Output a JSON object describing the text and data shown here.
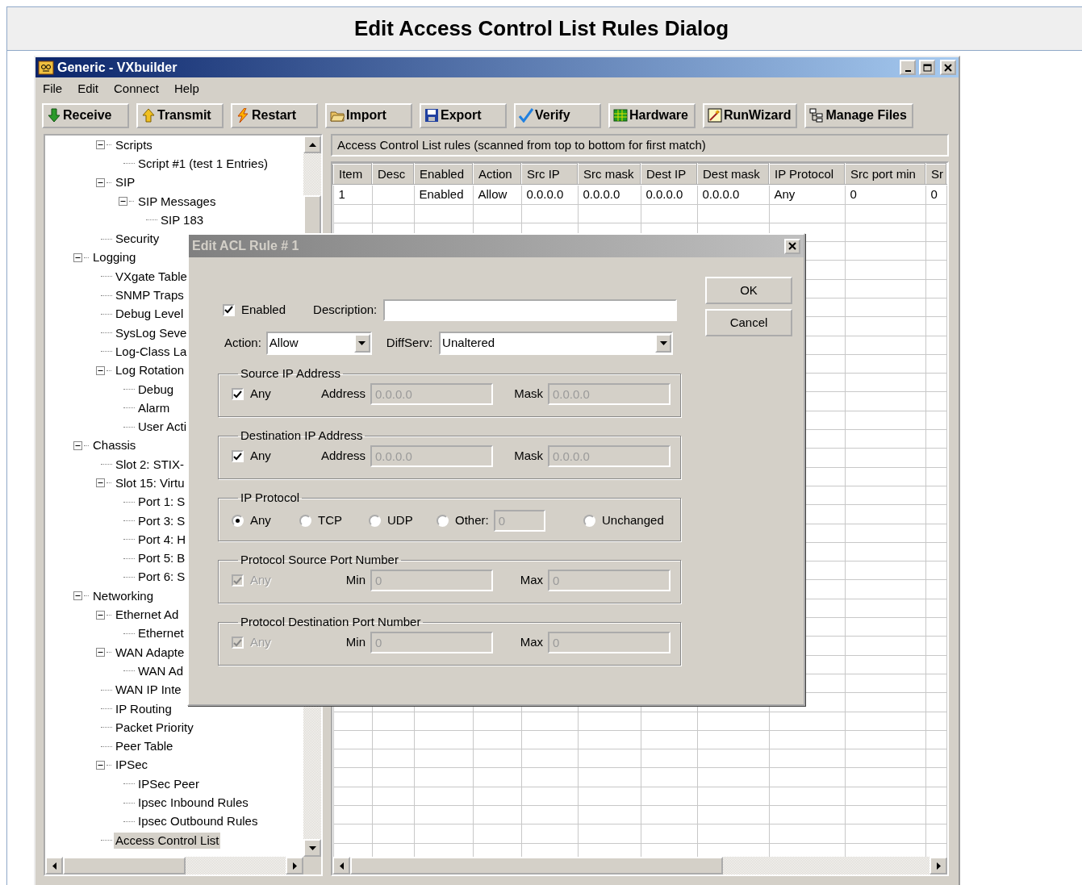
{
  "page_title": "Edit Access Control List Rules Dialog",
  "window": {
    "title": "Generic - VXbuilder"
  },
  "menu": [
    "File",
    "Edit",
    "Connect",
    "Help"
  ],
  "toolbar": [
    "Receive",
    "Transmit",
    "Restart",
    "Import",
    "Export",
    "Verify",
    "Hardware",
    "RunWizard",
    "Manage Files"
  ],
  "tree": {
    "items": [
      {
        "children": [
          {
            "label": "Scripts",
            "expanded": true,
            "selected": false,
            "children": [
              {
                "label": "Script #1 (test 1 Entries)",
                "selected": false
              }
            ]
          },
          {
            "label": "SIP",
            "expanded": true,
            "selected": false,
            "children": [
              {
                "label": "SIP Messages",
                "expanded": true,
                "selected": false,
                "children": [
                  {
                    "label": "SIP 183",
                    "selected": false
                  }
                ]
              }
            ]
          },
          {
            "label": "Security",
            "selected": false
          }
        ]
      },
      {
        "label": "Logging",
        "expanded": true,
        "selected": false,
        "children": [
          {
            "label": "VXgate Table",
            "selected": false
          },
          {
            "label": "SNMP Traps",
            "selected": false
          },
          {
            "label": "Debug Level",
            "selected": false
          },
          {
            "label": "SysLog Seve",
            "selected": false
          },
          {
            "label": "Log-Class La",
            "selected": false
          },
          {
            "label": "Log Rotation",
            "expanded": true,
            "selected": false,
            "children": [
              {
                "label": "Debug",
                "selected": false
              },
              {
                "label": "Alarm",
                "selected": false
              },
              {
                "label": "User Acti",
                "selected": false
              }
            ]
          }
        ]
      },
      {
        "label": "Chassis",
        "expanded": true,
        "selected": false,
        "children": [
          {
            "label": "Slot 2: STIX-",
            "selected": false
          },
          {
            "label": "Slot 15: Virtu",
            "expanded": true,
            "selected": false,
            "children": [
              {
                "label": "Port 1: S",
                "selected": false
              },
              {
                "label": "Port 3: S",
                "selected": false
              },
              {
                "label": "Port 4: H",
                "selected": false
              },
              {
                "label": "Port 5: B",
                "selected": false
              },
              {
                "label": "Port 6: S",
                "selected": false
              }
            ]
          }
        ]
      },
      {
        "label": "Networking",
        "expanded": true,
        "selected": false,
        "children": [
          {
            "label": "Ethernet Ad",
            "expanded": true,
            "selected": false,
            "children": [
              {
                "label": "Ethernet",
                "selected": false
              }
            ]
          },
          {
            "label": "WAN Adapte",
            "expanded": true,
            "selected": false,
            "children": [
              {
                "label": "WAN Ad",
                "selected": false
              }
            ]
          },
          {
            "label": "WAN IP Inte",
            "selected": false
          },
          {
            "label": "IP Routing",
            "selected": false
          },
          {
            "label": "Packet Priority",
            "selected": false
          },
          {
            "label": "Peer Table",
            "selected": false
          },
          {
            "label": "IPSec",
            "expanded": true,
            "selected": false,
            "children": [
              {
                "label": "IPSec Peer",
                "selected": false
              },
              {
                "label": "Ipsec Inbound Rules",
                "selected": false
              },
              {
                "label": "Ipsec Outbound Rules",
                "selected": false
              }
            ]
          },
          {
            "label": "Access Control List",
            "selected": true
          }
        ]
      }
    ]
  },
  "table": {
    "caption": "Access Control List rules (scanned from top to bottom for first match)",
    "columns": [
      "Item",
      "Desc",
      "Enabled",
      "Action",
      "Src IP",
      "Src mask",
      "Dest IP",
      "Dest mask",
      "IP Protocol",
      "Src port min",
      "Sr"
    ],
    "rows": [
      [
        "1",
        null,
        "Enabled",
        "Allow",
        "0.0.0.0",
        "0.0.0.0",
        "0.0.0.0",
        "0.0.0.0",
        "Any",
        "0",
        "0"
      ]
    ]
  },
  "dialog": {
    "title": "Edit ACL Rule # 1",
    "enabled": {
      "label": "Enabled",
      "checked": true
    },
    "description": {
      "label": "Description:"
    },
    "action": {
      "label": "Action:",
      "value": "Allow"
    },
    "diffserv": {
      "label": "DiffServ:",
      "value": "Unaltered"
    },
    "groups": [
      {
        "kind": "address",
        "title": "Source IP Address",
        "any": {
          "label": "Any",
          "checked": true,
          "disabled": false
        },
        "fields": [
          {
            "label": "Address",
            "value": "0.0.0.0",
            "disabled": true
          },
          {
            "label": "Mask",
            "value": "0.0.0.0",
            "disabled": true
          }
        ]
      },
      {
        "kind": "address",
        "title": "Destination IP Address",
        "any": {
          "label": "Any",
          "checked": true,
          "disabled": false
        },
        "fields": [
          {
            "label": "Address",
            "value": "0.0.0.0",
            "disabled": true
          },
          {
            "label": "Mask",
            "value": "0.0.0.0",
            "disabled": true
          }
        ]
      },
      {
        "kind": "protocol",
        "title": "IP Protocol",
        "options": [
          {
            "label": "Any",
            "selected": true
          },
          {
            "label": "TCP",
            "selected": false
          },
          {
            "label": "UDP",
            "selected": false
          },
          {
            "label": "Other:",
            "selected": false,
            "field": {
              "value": "0",
              "disabled": true
            }
          },
          {
            "label": "Unchanged",
            "selected": false
          }
        ]
      },
      {
        "kind": "address",
        "title": "Protocol Source Port Number",
        "any": {
          "label": "Any",
          "checked": true,
          "disabled": true
        },
        "fields": [
          {
            "label": "Min",
            "value": "0",
            "disabled": true
          },
          {
            "label": "Max",
            "value": "0",
            "disabled": true
          }
        ]
      },
      {
        "kind": "address",
        "title": "Protocol Destination Port Number",
        "any": {
          "label": "Any",
          "checked": true,
          "disabled": true
        },
        "fields": [
          {
            "label": "Min",
            "value": "0",
            "disabled": true
          },
          {
            "label": "Max",
            "value": "0",
            "disabled": true
          }
        ]
      }
    ],
    "buttons": [
      "OK",
      "Cancel"
    ]
  }
}
